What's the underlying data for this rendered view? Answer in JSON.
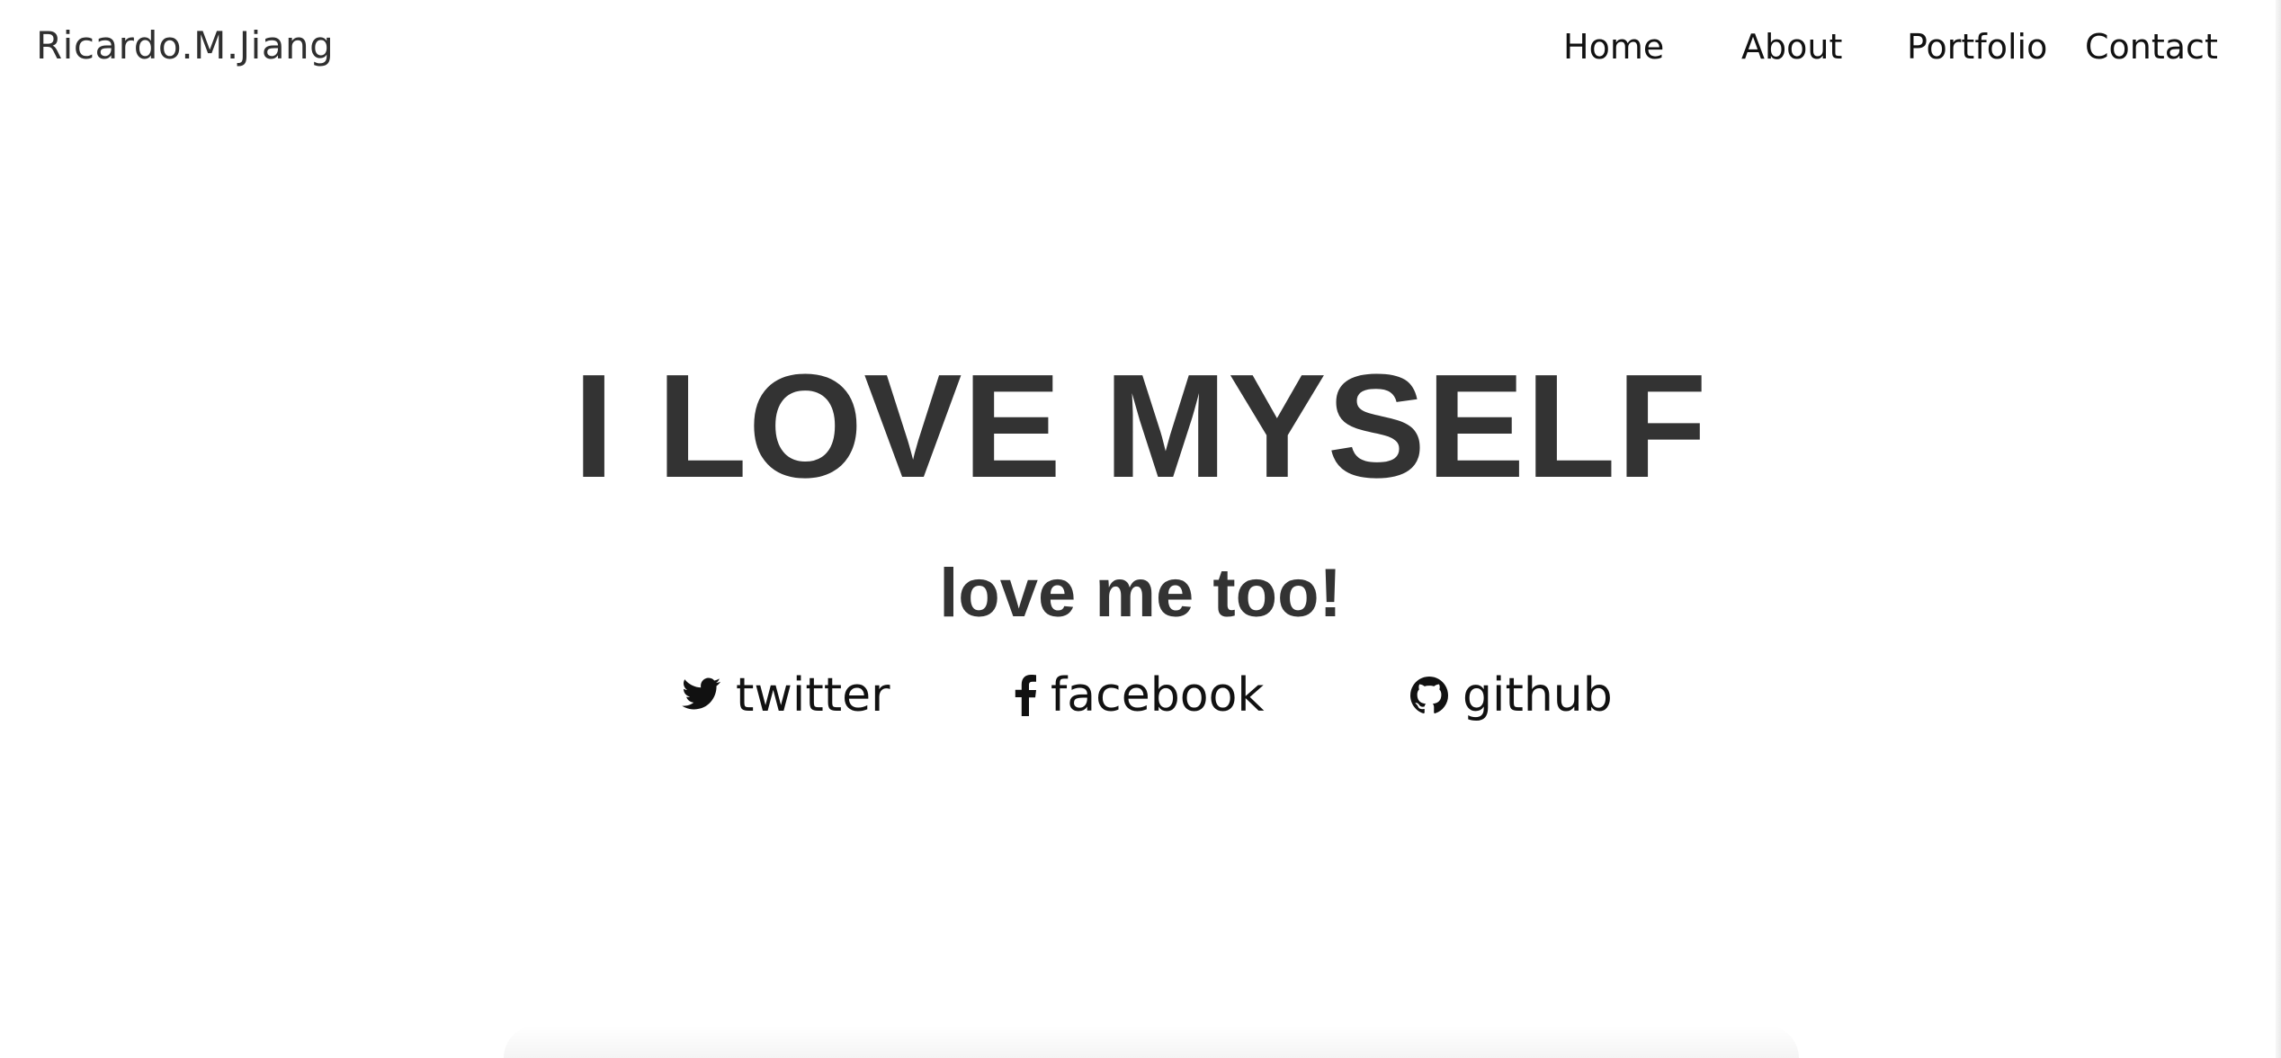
{
  "brand": {
    "name": "Ricardo.M.Jiang"
  },
  "nav": {
    "items": [
      {
        "label": "Home"
      },
      {
        "label": "About"
      },
      {
        "label": "Portfolio"
      },
      {
        "label": "Contact"
      }
    ]
  },
  "hero": {
    "title": "I LOVE MYSELF",
    "subtitle": "love me too!"
  },
  "social": {
    "links": [
      {
        "label": "twitter",
        "icon": "twitter-icon"
      },
      {
        "label": "facebook",
        "icon": "facebook-icon"
      },
      {
        "label": "github",
        "icon": "github-icon"
      }
    ]
  },
  "colors": {
    "background": "#ffffff",
    "heading": "#333333",
    "text": "#111111"
  }
}
